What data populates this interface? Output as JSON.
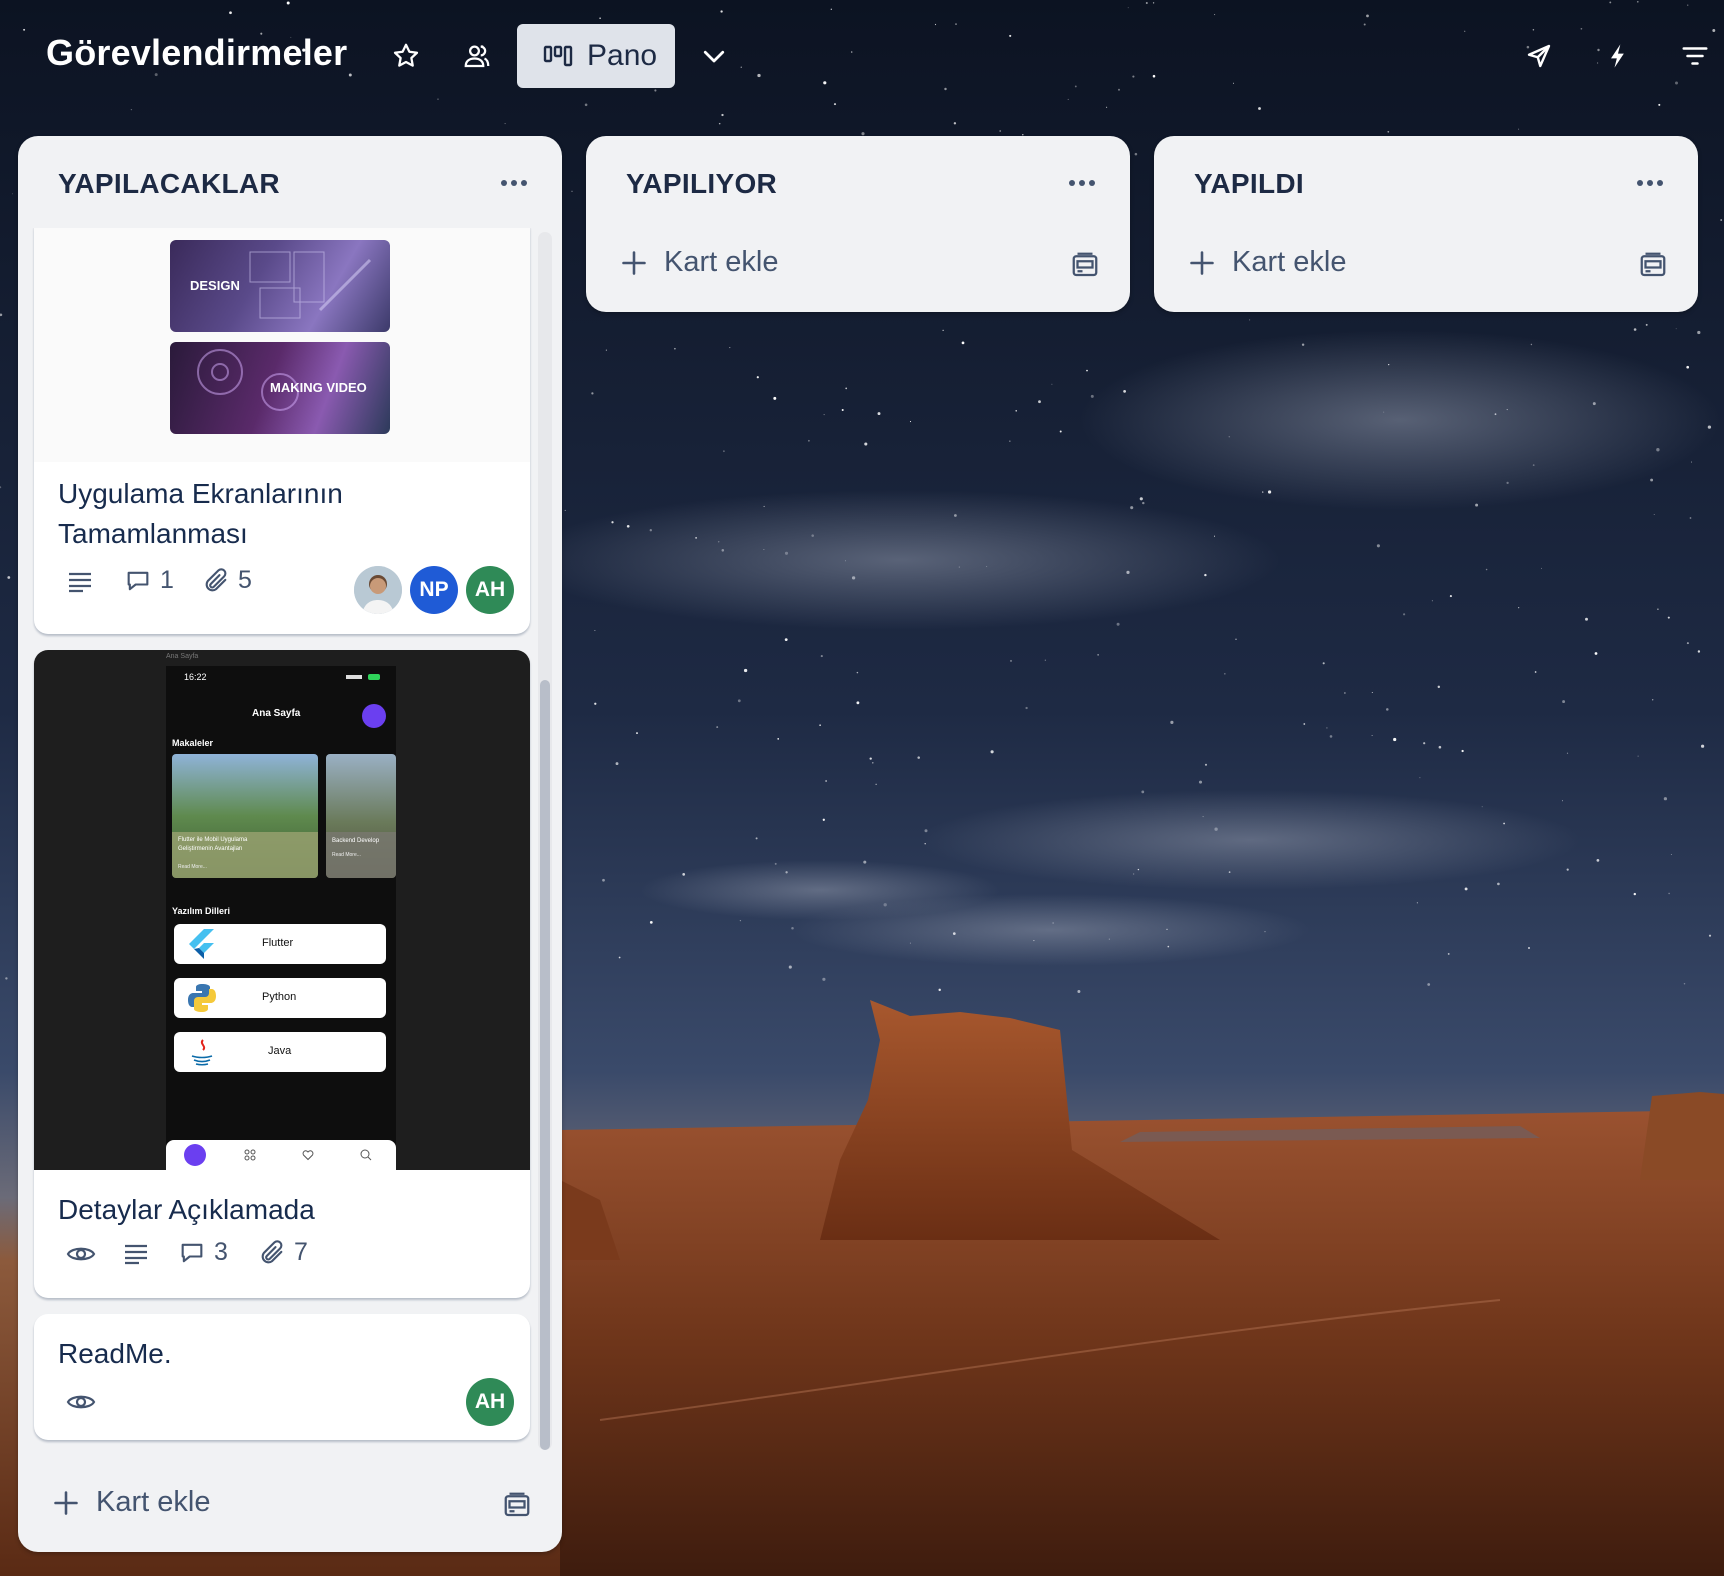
{
  "header": {
    "board_title": "Görevlendirmeler",
    "view_label": "Pano",
    "icons": [
      "star-icon",
      "workspace-visible-icon",
      "board-view-icon",
      "chevron-down-icon",
      "power-ups-icon",
      "automation-icon",
      "filter-icon"
    ]
  },
  "lists": [
    {
      "title": "YAPILACAKLAR",
      "add_card_label": "Kart ekle",
      "cards": [
        {
          "cover_labels": [
            "DESIGN",
            "MAKING VIDEO"
          ],
          "title": "Uygulama Ekranlarının Tamamlanması",
          "comments": "1",
          "attachments": "5",
          "members": [
            "NP",
            "AH"
          ]
        },
        {
          "cover": {
            "caption": "Ana Sayfa",
            "time": "16:22",
            "screen_title": "Ana Sayfa",
            "section_articles": "Makaleler",
            "article_1": "Flutter ile Mobil Uygulama Geliştirmenin Avantajları",
            "article_1_more": "Read More...",
            "article_2": "Backend Develop",
            "article_2_more": "Read More...",
            "section_languages": "Yazılım Dilleri",
            "languages": [
              "Flutter",
              "Python",
              "Java"
            ]
          },
          "title": "Detaylar Açıklamada",
          "comments": "3",
          "attachments": "7"
        },
        {
          "title": "ReadMe.",
          "members": [
            "AH"
          ]
        }
      ]
    },
    {
      "title": "YAPILIYOR",
      "add_card_label": "Kart ekle"
    },
    {
      "title": "YAPILDI",
      "add_card_label": "Kart ekle"
    }
  ],
  "colors": {
    "list_bg": "#f1f2f4",
    "avatar_np": "#1f5bd6",
    "avatar_ah": "#2f8a57",
    "text_primary": "#172b4d",
    "text_secondary": "#44546f"
  }
}
